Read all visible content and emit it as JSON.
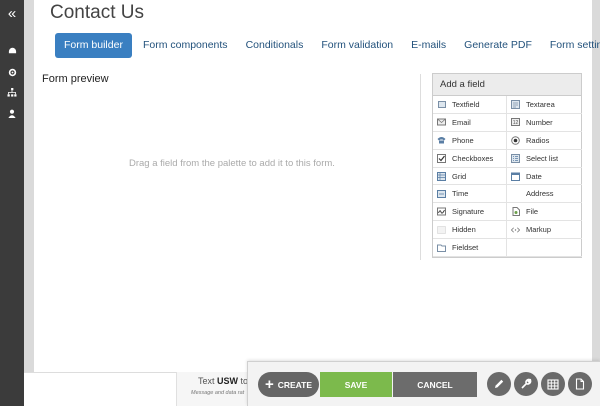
{
  "page": {
    "title": "Contact Us"
  },
  "tabs": [
    {
      "label": "Form builder",
      "active": true
    },
    {
      "label": "Form components"
    },
    {
      "label": "Conditionals"
    },
    {
      "label": "Form validation"
    },
    {
      "label": "E-mails"
    },
    {
      "label": "Generate PDF"
    },
    {
      "label": "Form settings"
    }
  ],
  "preview": {
    "label": "Form preview",
    "hint": "Drag a field from the palette to add it to this form."
  },
  "palette": {
    "header": "Add a field",
    "items": [
      {
        "label": "Textfield",
        "icon": "textfield-icon"
      },
      {
        "label": "Textarea",
        "icon": "textarea-icon"
      },
      {
        "label": "Email",
        "icon": "email-icon"
      },
      {
        "label": "Number",
        "icon": "number-icon"
      },
      {
        "label": "Phone",
        "icon": "phone-icon"
      },
      {
        "label": "Radios",
        "icon": "radio-icon"
      },
      {
        "label": "Checkboxes",
        "icon": "checkbox-icon"
      },
      {
        "label": "Select list",
        "icon": "select-list-icon"
      },
      {
        "label": "Grid",
        "icon": "grid-icon"
      },
      {
        "label": "Date",
        "icon": "date-icon"
      },
      {
        "label": "Time",
        "icon": "time-icon"
      },
      {
        "label": "Address",
        "icon": "address-icon"
      },
      {
        "label": "Signature",
        "icon": "signature-icon"
      },
      {
        "label": "File",
        "icon": "file-icon"
      },
      {
        "label": "Hidden",
        "icon": "hidden-icon"
      },
      {
        "label": "Markup",
        "icon": "markup-icon"
      },
      {
        "label": "Fieldset",
        "icon": "fieldset-icon"
      },
      {
        "label": "",
        "icon": ""
      }
    ]
  },
  "notice": {
    "prefix": "Text ",
    "keyword": "USW",
    "suffix": " to",
    "subtext": "Message and data rat"
  },
  "actions": {
    "create": "CREATE",
    "save": "SAVE",
    "cancel": "CANCEL"
  },
  "colors": {
    "accent": "#3a7fc1",
    "save": "#7cba4c",
    "cancel": "#6c6c6c",
    "sidebar": "#3b3b3b"
  }
}
